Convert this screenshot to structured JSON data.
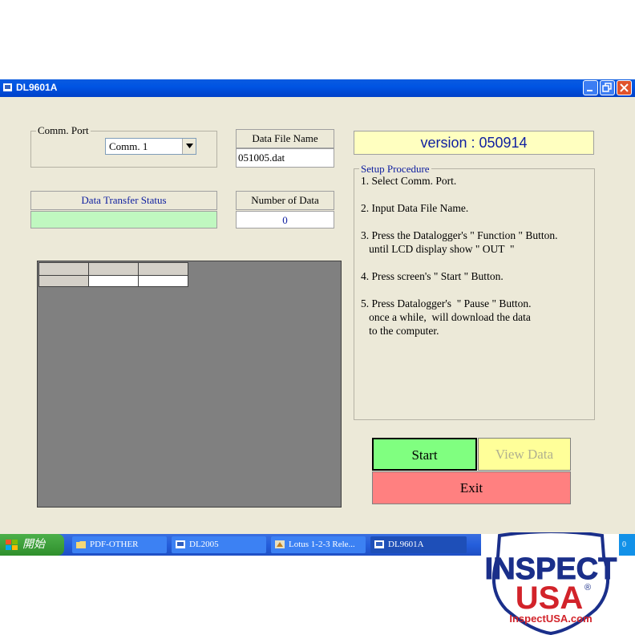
{
  "window": {
    "title": "DL9601A"
  },
  "comm_port": {
    "legend": "Comm. Port",
    "selected": "Comm. 1"
  },
  "data_file": {
    "label": "Data File Name",
    "value": "051005.dat"
  },
  "version": {
    "text": "version : 050914"
  },
  "status": {
    "label": "Data Transfer Status",
    "value": ""
  },
  "number_of_data": {
    "label": "Number of  Data",
    "value": "0"
  },
  "setup": {
    "legend": "Setup Procedure",
    "steps": [
      "1. Select Comm. Port.",
      "2. Input Data File Name.",
      "3. Press the Datalogger's \" Function \" Button.\n   until LCD display show \" OUT  \"",
      "4. Press screen's \" Start \" Button.",
      "5. Press Datalogger's  \" Pause \" Button.\n   once a while,  will download the data\n   to the computer."
    ]
  },
  "buttons": {
    "start": "Start",
    "view_data": "View Data",
    "exit": "Exit"
  },
  "taskbar": {
    "start_label": "開始",
    "items": [
      {
        "label": "PDF-OTHER",
        "icon": "folder-icon"
      },
      {
        "label": "DL2005",
        "icon": "app-icon"
      },
      {
        "label": "Lotus 1-2-3 Rele...",
        "icon": "lotus-icon"
      },
      {
        "label": "DL9601A",
        "icon": "app-icon"
      }
    ],
    "tray_text": "0"
  },
  "logo": {
    "line1": "INSPECT",
    "line2": "USA",
    "registered": "®",
    "url": "InspectUSA.com"
  },
  "colors": {
    "status_bar": "#c0f8c0",
    "start_button": "#80ff80",
    "view_data_button": "#ffff99",
    "exit_button": "#ff8080",
    "version_bg": "#ffffc0",
    "title_accent": "#1020a0"
  }
}
